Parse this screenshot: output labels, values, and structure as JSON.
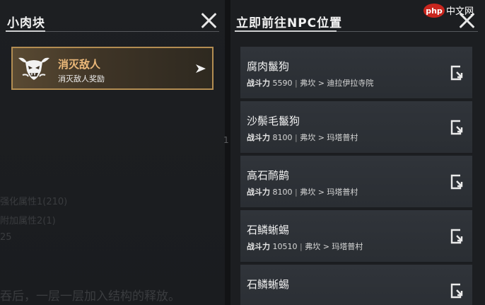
{
  "left_panel": {
    "title": "小肉块",
    "quest": {
      "title": "消灭敌人",
      "subtitle": "消灭敌人奖励",
      "icon": "demon-skull-icon",
      "arrow_icon": "arrow-right-icon"
    },
    "ghost_lines": [
      "强化属性1(210)",
      "附加属性2(1)",
      "25",
      "吞后，一层一层加入结构的释放。"
    ]
  },
  "divider_mark": "1",
  "right_panel": {
    "title": "立即前往NPC位置",
    "watermark": "php 中文网",
    "npcs": [
      {
        "name": "腐肉鬣狗",
        "power_label": "战斗力",
        "power": "5590",
        "location": "弗坎 > 迪拉伊拉寺院"
      },
      {
        "name": "沙鬃毛鬣狗",
        "power_label": "战斗力",
        "power": "8100",
        "location": "弗坎 > 玛塔普村"
      },
      {
        "name": "高石鸸鹋",
        "power_label": "战斗力",
        "power": "8100",
        "location": "弗坎 > 玛塔普村"
      },
      {
        "name": "石鳞蜥蜴",
        "power_label": "战斗力",
        "power": "10510",
        "location": "弗坎 > 玛塔普村"
      },
      {
        "name": "石鳞蜥蜴",
        "power_label": "战斗力",
        "power": "",
        "location": ""
      }
    ]
  },
  "colors": {
    "quest_border": "#b38d52",
    "quest_title": "#ecb97a",
    "card_bg": "#30343a",
    "panel_bg": "#1c1e21"
  }
}
